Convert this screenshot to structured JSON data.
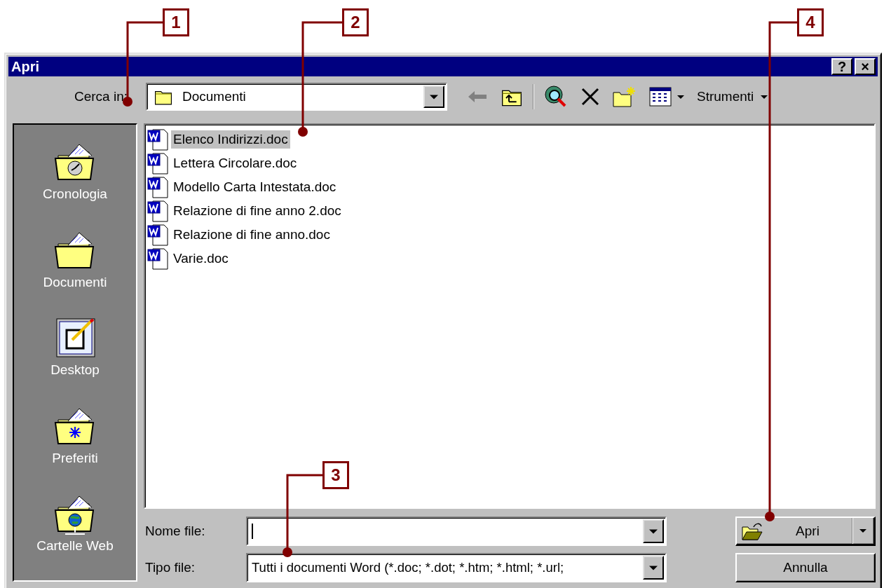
{
  "window": {
    "title": "Apri",
    "title_buttons": [
      "?",
      "×"
    ]
  },
  "look_in": {
    "label": "Cerca in:",
    "value": "Documenti"
  },
  "toolbar": {
    "back_disabled": true,
    "tools_menu": "Strumenti"
  },
  "places": [
    {
      "label": "Cronologia"
    },
    {
      "label": "Documenti"
    },
    {
      "label": "Desktop"
    },
    {
      "label": "Preferiti"
    },
    {
      "label": "Cartelle Web"
    }
  ],
  "files": [
    {
      "name": "Elenco Indirizzi.doc",
      "selected": true
    },
    {
      "name": "Lettera Circolare.doc",
      "selected": false
    },
    {
      "name": "Modello Carta Intestata.doc",
      "selected": false
    },
    {
      "name": "Relazione di fine anno 2.doc",
      "selected": false
    },
    {
      "name": "Relazione di fine anno.doc",
      "selected": false
    },
    {
      "name": "Varie.doc",
      "selected": false
    }
  ],
  "file_name": {
    "label": "Nome file:"
  },
  "file_type": {
    "label": "Tipo file:",
    "value": "Tutti i documenti Word (*.doc; *.dot; *.htm; *.html; *.url;"
  },
  "buttons": [
    {
      "label": "Apri",
      "kind": "split"
    },
    {
      "label": "Annulla",
      "kind": "plain"
    }
  ],
  "callouts": [
    "1",
    "2",
    "3",
    "4"
  ]
}
